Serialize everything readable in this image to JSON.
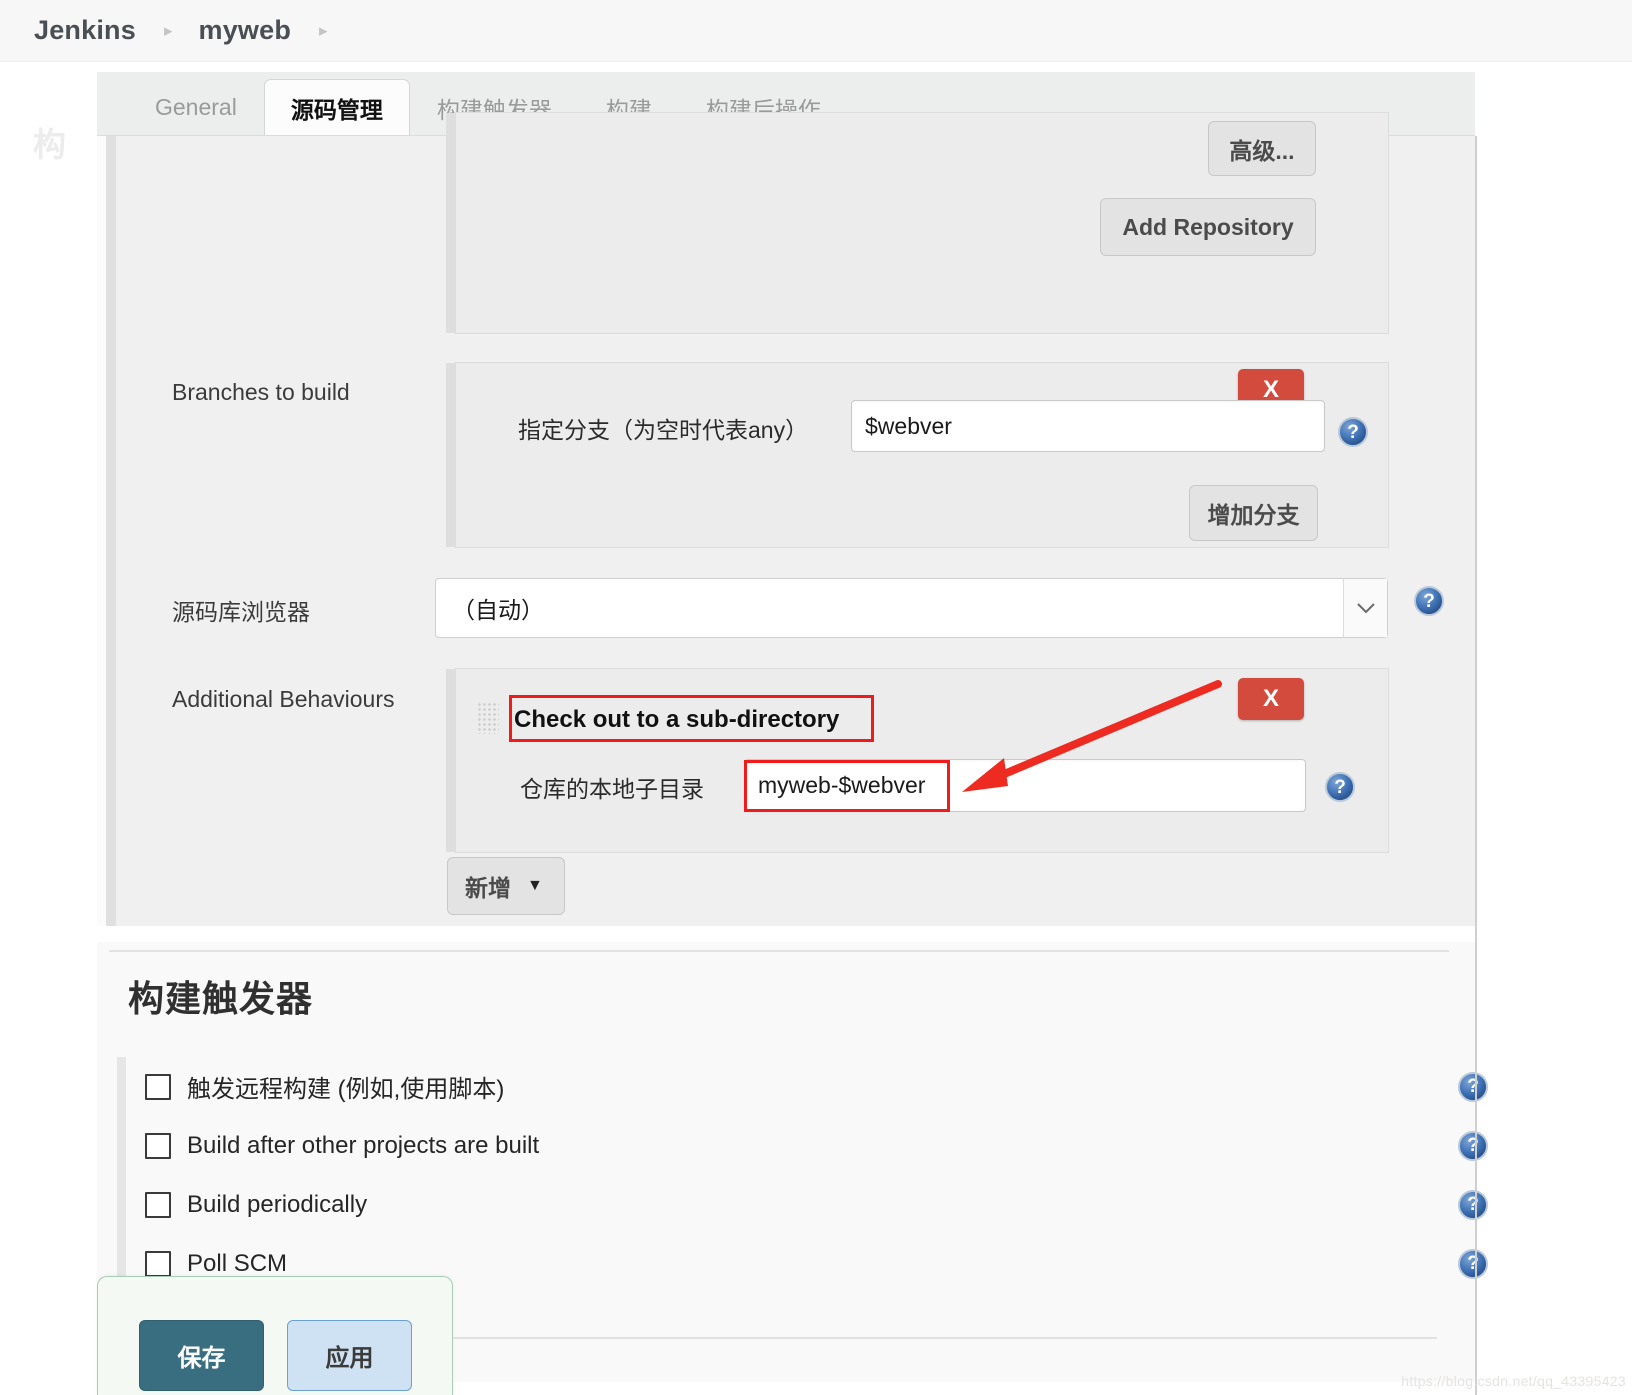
{
  "breadcrumb": {
    "items": [
      {
        "label": "Jenkins"
      },
      {
        "label": "myweb"
      }
    ],
    "separator": "▸"
  },
  "tabs": [
    {
      "label": "General",
      "active": false
    },
    {
      "label": "源码管理",
      "active": true
    },
    {
      "label": "构建触发器",
      "active": false
    },
    {
      "label": "构建",
      "active": false
    },
    {
      "label": "构建后操作",
      "active": false
    }
  ],
  "scm": {
    "advanced_button": "高级...",
    "add_repository_button": "Add Repository",
    "branches": {
      "label": "Branches to build",
      "remove_button": "X",
      "field_label": "指定分支（为空时代表any）",
      "field_value": "$webver",
      "add_branch_button": "增加分支",
      "help_icon": "help-icon"
    },
    "repo_browser": {
      "label": "源码库浏览器",
      "selected": "（自动）",
      "chevron": "⌄",
      "help_icon": "help-icon"
    },
    "additional_behaviours": {
      "label": "Additional Behaviours",
      "remove_button": "X",
      "behaviour_title": "Check out to a sub-directory",
      "subdir_label": "仓库的本地子目录",
      "subdir_value": "myweb-$webver",
      "help_icon": "help-icon",
      "add_button": "新增",
      "add_button_caret": "▼"
    }
  },
  "triggers": {
    "title": "构建触发器",
    "items": [
      {
        "label": "触发远程构建 (例如,使用脚本)",
        "checked": false
      },
      {
        "label": "Build after other projects are built",
        "checked": false
      },
      {
        "label": "Build periodically",
        "checked": false
      },
      {
        "label": "Poll SCM",
        "checked": false
      }
    ]
  },
  "footer": {
    "save_button": "保存",
    "apply_button": "应用",
    "ghost_text": "构",
    "watermark": "https://blog.csdn.net/qq_43395423"
  },
  "colors": {
    "accent_red": "#d24b3c",
    "annotation_red": "#f01c1c",
    "save_teal": "#386e7f",
    "apply_blue": "#cfe2f3",
    "help_blue": "#3f72b5"
  }
}
